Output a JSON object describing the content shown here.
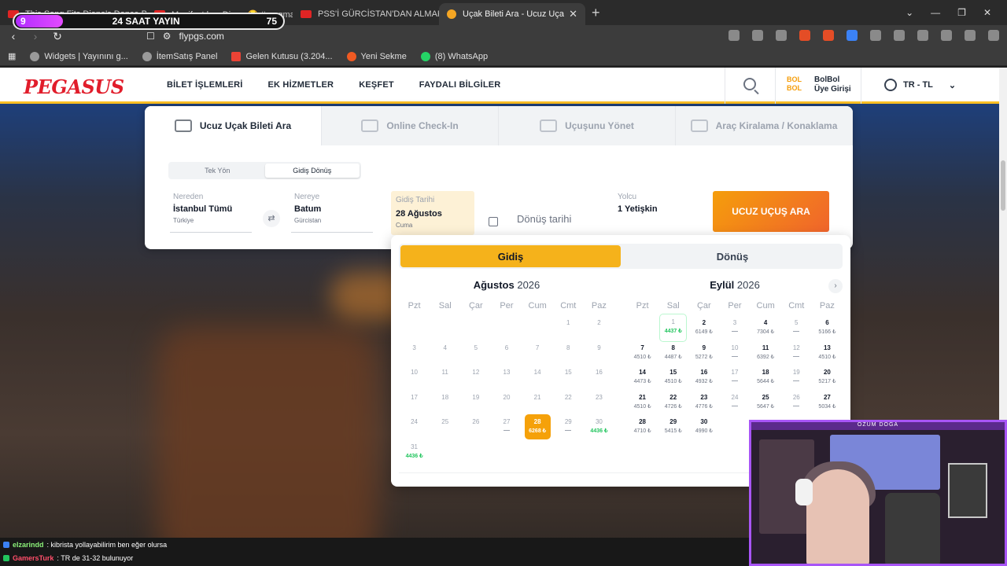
{
  "browser": {
    "tabs": [
      {
        "title": "This Song Fits Diana's Dance Perfect..."
      },
      {
        "title": "Manifest kızı Diana 😂 #pragmata..."
      },
      {
        "title": "PSS'İ GÜRCİSTAN'DAN ALMAK MAN..."
      },
      {
        "title": "Uçak Bileti Ara - Ucuz Uçak Bileti..."
      }
    ],
    "new_tab": "+",
    "url": "flypgs.com",
    "bookmarks": [
      "Widgets | Yayınını g...",
      "İtemSatış Panel",
      "Gelen Kutusu (3.204...",
      "Yeni Sekme",
      "(8) WhatsApp"
    ]
  },
  "stream_overlay": {
    "left": "9",
    "title": "24 SAAT YAYIN",
    "right": "75"
  },
  "site": {
    "logo": "PEGASUS",
    "nav": [
      "BİLET İŞLEMLERİ",
      "EK HİZMETLER",
      "KEŞFET",
      "FAYDALI BİLGİLER"
    ],
    "bolbol_logo": "BOL BOL",
    "bolbol_line1": "BolBol",
    "bolbol_line2": "Üye Girişi",
    "lang": "TR - TL"
  },
  "search": {
    "tabs": [
      "Ucuz Uçak Bileti Ara",
      "Online Check-In",
      "Uçuşunu Yönet",
      "Araç Kiralama / Konaklama"
    ],
    "trip_types": [
      "Tek Yön",
      "Gidiş Dönüş"
    ],
    "from": {
      "label": "Nereden",
      "value": "İstanbul Tümü",
      "sub": "Türkiye"
    },
    "to": {
      "label": "Nereye",
      "value": "Batum",
      "sub": "Gürcistan"
    },
    "depart": {
      "label": "Gidiş Tarihi",
      "value": "28 Ağustos",
      "sub": "Cuma"
    },
    "return_placeholder": "Dönüş tarihi",
    "pax": {
      "label": "Yolcu",
      "value": "1 Yetişkin"
    },
    "button": "UCUZ UÇUŞ ARA"
  },
  "calendar": {
    "tabs": [
      "Gidiş",
      "Dönüş"
    ],
    "dow": [
      "Pzt",
      "Sal",
      "Çar",
      "Per",
      "Cum",
      "Cmt",
      "Paz"
    ],
    "months": [
      {
        "name": "Ağustos",
        "year": "2026",
        "days": [
          {
            "d": "",
            "p": ""
          },
          {
            "d": "",
            "p": ""
          },
          {
            "d": "",
            "p": ""
          },
          {
            "d": "",
            "p": ""
          },
          {
            "d": "",
            "p": ""
          },
          {
            "d": "1",
            "p": ""
          },
          {
            "d": "2",
            "p": ""
          },
          {
            "d": "3",
            "p": ""
          },
          {
            "d": "4",
            "p": ""
          },
          {
            "d": "5",
            "p": ""
          },
          {
            "d": "6",
            "p": ""
          },
          {
            "d": "7",
            "p": ""
          },
          {
            "d": "8",
            "p": ""
          },
          {
            "d": "9",
            "p": ""
          },
          {
            "d": "10",
            "p": ""
          },
          {
            "d": "11",
            "p": ""
          },
          {
            "d": "12",
            "p": ""
          },
          {
            "d": "13",
            "p": ""
          },
          {
            "d": "14",
            "p": ""
          },
          {
            "d": "15",
            "p": ""
          },
          {
            "d": "16",
            "p": ""
          },
          {
            "d": "17",
            "p": ""
          },
          {
            "d": "18",
            "p": ""
          },
          {
            "d": "19",
            "p": ""
          },
          {
            "d": "20",
            "p": ""
          },
          {
            "d": "21",
            "p": ""
          },
          {
            "d": "22",
            "p": ""
          },
          {
            "d": "23",
            "p": ""
          },
          {
            "d": "24",
            "p": ""
          },
          {
            "d": "25",
            "p": ""
          },
          {
            "d": "26",
            "p": ""
          },
          {
            "d": "27",
            "p": "—",
            "s": "na"
          },
          {
            "d": "28",
            "p": "6268 ₺",
            "s": "sel"
          },
          {
            "d": "29",
            "p": "—",
            "s": "na"
          },
          {
            "d": "30",
            "p": "4436 ₺",
            "s": "low"
          },
          {
            "d": "31",
            "p": "4436 ₺",
            "s": "low"
          }
        ]
      },
      {
        "name": "Eylül",
        "year": "2026",
        "days": [
          {
            "d": "",
            "p": ""
          },
          {
            "d": "1",
            "p": "4437 ₺",
            "s": "low hover"
          },
          {
            "d": "2",
            "p": "6149 ₺",
            "s": "av"
          },
          {
            "d": "3",
            "p": "—",
            "s": "na"
          },
          {
            "d": "4",
            "p": "7304 ₺",
            "s": "av"
          },
          {
            "d": "5",
            "p": "—",
            "s": "na"
          },
          {
            "d": "6",
            "p": "5166 ₺",
            "s": "av"
          },
          {
            "d": "7",
            "p": "4510 ₺",
            "s": "av"
          },
          {
            "d": "8",
            "p": "4487 ₺",
            "s": "av"
          },
          {
            "d": "9",
            "p": "5272 ₺",
            "s": "av"
          },
          {
            "d": "10",
            "p": "—",
            "s": "na"
          },
          {
            "d": "11",
            "p": "6392 ₺",
            "s": "av"
          },
          {
            "d": "12",
            "p": "—",
            "s": "na"
          },
          {
            "d": "13",
            "p": "4510 ₺",
            "s": "av"
          },
          {
            "d": "14",
            "p": "4473 ₺",
            "s": "av"
          },
          {
            "d": "15",
            "p": "4510 ₺",
            "s": "av"
          },
          {
            "d": "16",
            "p": "4932 ₺",
            "s": "av"
          },
          {
            "d": "17",
            "p": "—",
            "s": "na"
          },
          {
            "d": "18",
            "p": "5644 ₺",
            "s": "av"
          },
          {
            "d": "19",
            "p": "—",
            "s": "na"
          },
          {
            "d": "20",
            "p": "5217 ₺",
            "s": "av"
          },
          {
            "d": "21",
            "p": "4510 ₺",
            "s": "av"
          },
          {
            "d": "22",
            "p": "4726 ₺",
            "s": "av"
          },
          {
            "d": "23",
            "p": "4776 ₺",
            "s": "av"
          },
          {
            "d": "24",
            "p": "—",
            "s": "na"
          },
          {
            "d": "25",
            "p": "5647 ₺",
            "s": "av"
          },
          {
            "d": "26",
            "p": "—",
            "s": "na"
          },
          {
            "d": "27",
            "p": "5034 ₺",
            "s": "av"
          },
          {
            "d": "28",
            "p": "4710 ₺",
            "s": "av"
          },
          {
            "d": "29",
            "p": "5415 ₺",
            "s": "av"
          },
          {
            "d": "30",
            "p": "4990 ₺",
            "s": "av"
          }
        ]
      }
    ],
    "next": "›"
  },
  "chat": [
    {
      "user": "elzarindd",
      "msg": ": kibrista yollayabilirim ben eğer olursa"
    },
    {
      "user": "GamersTurk",
      "msg": ": TR de 31-32 bulunuyor"
    }
  ],
  "webcam": {
    "label": "ÖZÜM DOĞA"
  }
}
